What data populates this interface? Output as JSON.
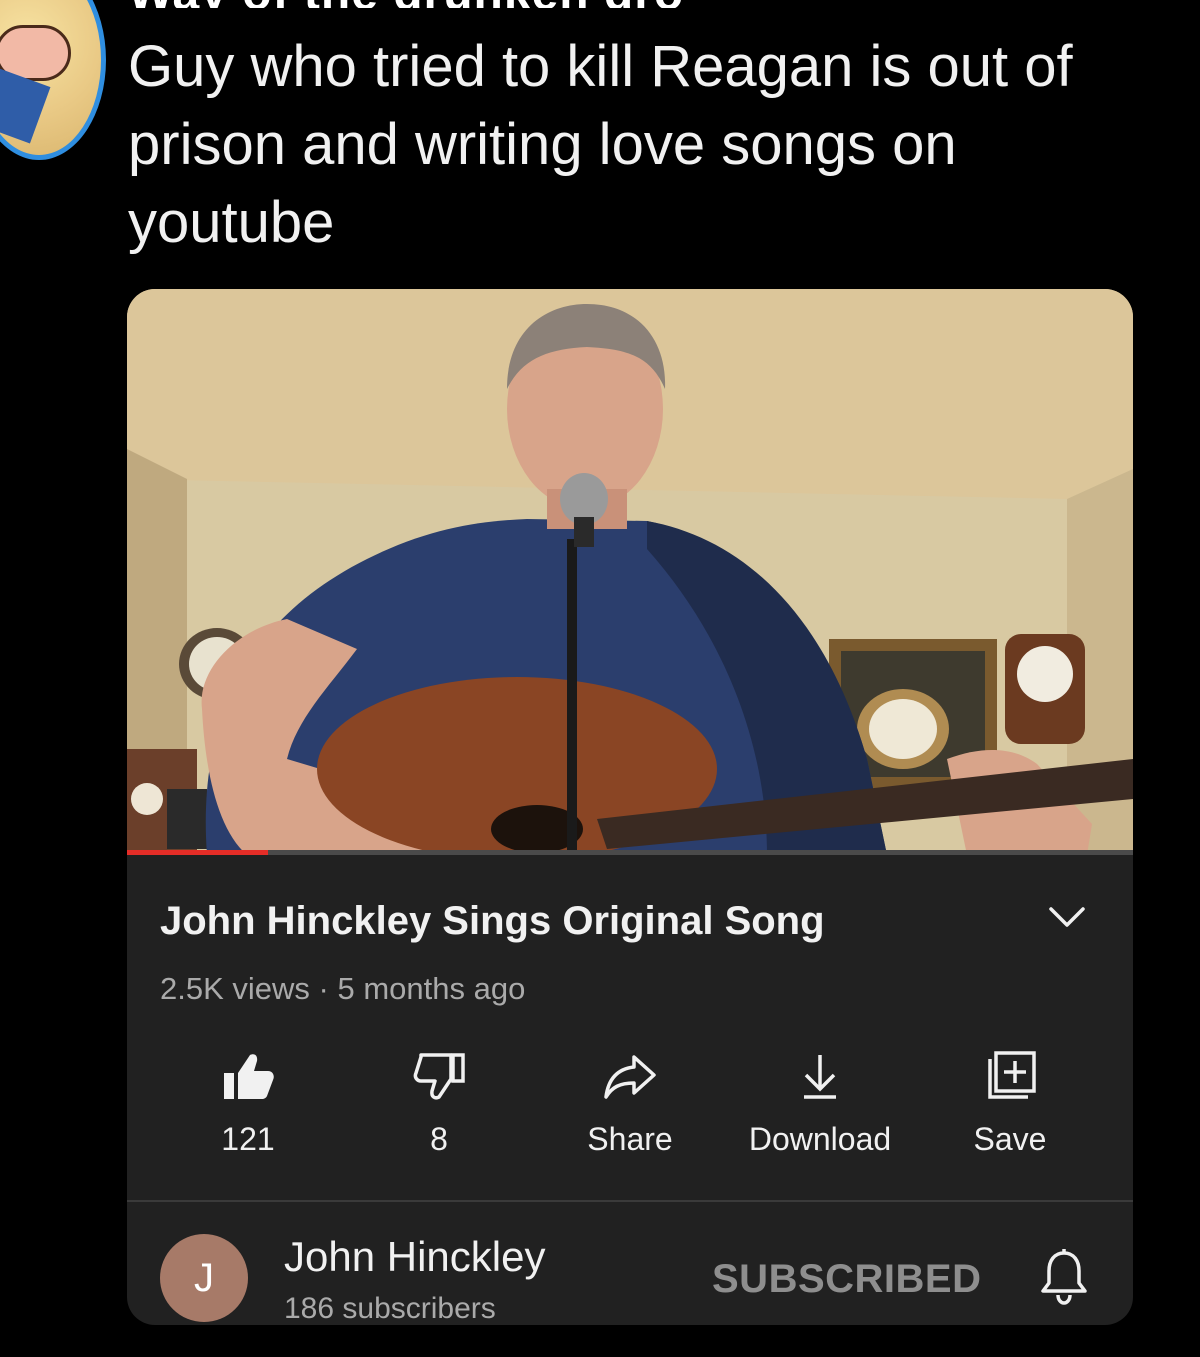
{
  "tweet": {
    "header_fragment": "Way of the drunken dro",
    "text": "Guy who tried to kill Reagan is out of prison and writing love songs on youtube"
  },
  "video": {
    "title": "John Hinckley Sings Original Song",
    "views": "2.5K views",
    "separator": "·",
    "age": "5 months ago",
    "progress": 0.14
  },
  "actions": {
    "like_count": "121",
    "dislike_count": "8",
    "share_label": "Share",
    "download_label": "Download",
    "save_label": "Save"
  },
  "channel": {
    "avatar_letter": "J",
    "name": "John Hinckley",
    "subscribers": "186 subscribers",
    "subscribe_state": "SUBSCRIBED"
  },
  "icons": {
    "expand": "chevron-down-icon",
    "like": "thumbs-up-icon",
    "dislike": "thumbs-down-icon",
    "share": "share-arrow-icon",
    "download": "download-icon",
    "save": "playlist-add-icon",
    "notifications": "bell-icon"
  },
  "colors": {
    "background": "#000000",
    "card": "#212121",
    "progress": "#e52d27",
    "avatar_ring": "#2f8ee0",
    "channel_avatar": "#a77a68"
  }
}
